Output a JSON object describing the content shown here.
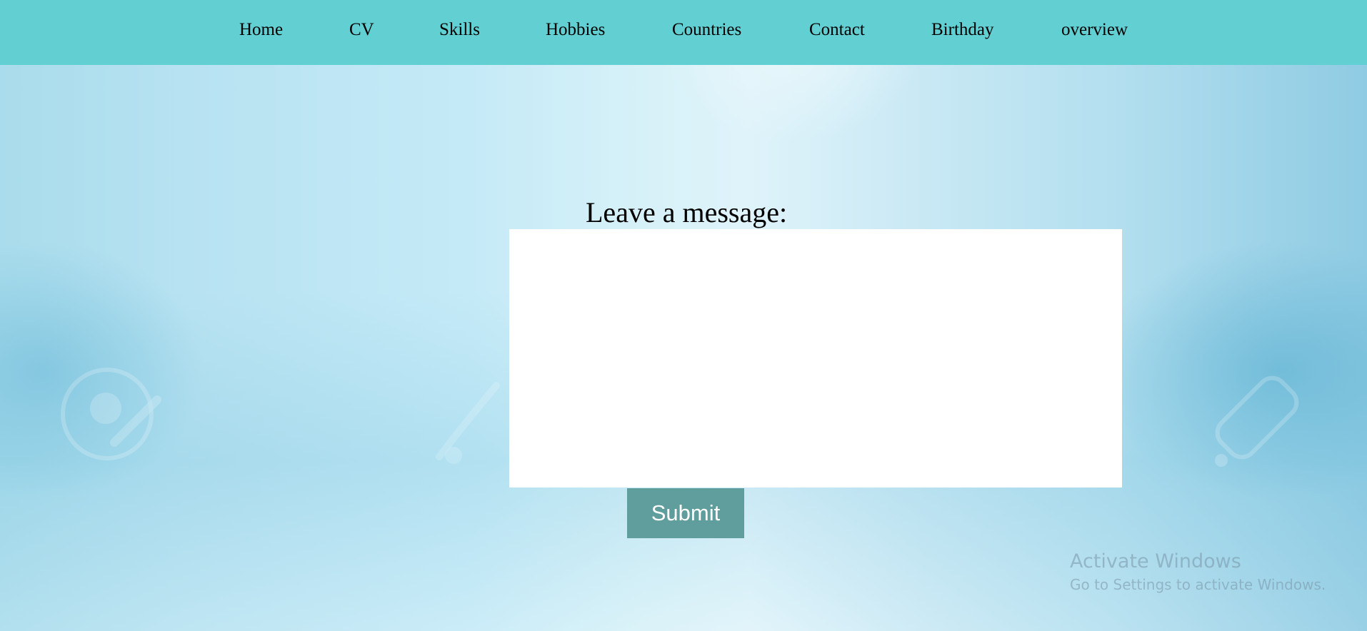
{
  "nav": {
    "items": [
      {
        "label": "Home"
      },
      {
        "label": "CV"
      },
      {
        "label": "Skills"
      },
      {
        "label": "Hobbies"
      },
      {
        "label": "Countries"
      },
      {
        "label": "Contact"
      },
      {
        "label": "Birthday"
      },
      {
        "label": "overview"
      }
    ]
  },
  "form": {
    "label": "Leave a message:",
    "message_value": "",
    "submit_label": "Submit"
  },
  "watermark": {
    "title": "Activate Windows",
    "subtitle": "Go to Settings to activate Windows."
  },
  "colors": {
    "navbar": "#62d0d3",
    "submit_button": "#5f9e9c",
    "message_box": "#ffffff"
  }
}
